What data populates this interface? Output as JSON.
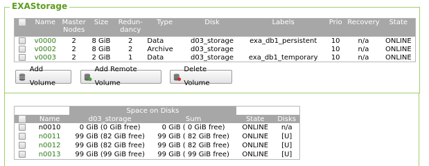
{
  "section": {
    "title": "EXAStorage"
  },
  "volumes": {
    "columns": [
      "Name",
      "Master Nodes",
      "Size",
      "Redun-dancy",
      "Type",
      "Disk",
      "Labels",
      "Prio",
      "Recovery",
      "State"
    ],
    "rows": [
      {
        "name": "v0000",
        "master_nodes": "2",
        "size": "8 GiB",
        "redundancy": "2",
        "type": "Data",
        "disk": "d03_storage",
        "labels": "exa_db1_persistent",
        "prio": "10",
        "recovery": "n/a",
        "state": "ONLINE"
      },
      {
        "name": "v0002",
        "master_nodes": "2",
        "size": "8 GiB",
        "redundancy": "2",
        "type": "Archive",
        "disk": "d03_storage",
        "labels": "",
        "prio": "10",
        "recovery": "n/a",
        "state": "ONLINE"
      },
      {
        "name": "v0003",
        "master_nodes": "2",
        "size": "2 GiB",
        "redundancy": "1",
        "type": "Data",
        "disk": "d03_storage",
        "labels": "exa_db1_temporary",
        "prio": "10",
        "recovery": "n/a",
        "state": "ONLINE"
      }
    ]
  },
  "buttons": {
    "add_volume": "Add Volume",
    "add_remote_volume": "Add Remote Volume",
    "delete_volume": "Delete Volume"
  },
  "disks": {
    "group_header": "Space on Disks",
    "columns": [
      "Name",
      "d03_storage",
      "Sum",
      "State",
      "Disks"
    ],
    "rows": [
      {
        "name": "n0010",
        "d03_storage": "0 GiB (0 GiB free)",
        "sum": "0 GiB ( 0 GiB free)",
        "state": "ONLINE",
        "disks": "n/a"
      },
      {
        "name": "n0011",
        "d03_storage": "99 GiB (82 GiB free)",
        "sum": "99 GiB ( 82 GiB free)",
        "state": "ONLINE",
        "disks": "[U]"
      },
      {
        "name": "n0012",
        "d03_storage": "99 GiB (82 GiB free)",
        "sum": "99 GiB ( 82 GiB free)",
        "state": "ONLINE",
        "disks": "[U]"
      },
      {
        "name": "n0013",
        "d03_storage": "99 GiB (99 GiB free)",
        "sum": "99 GiB ( 99 GiB free)",
        "state": "ONLINE",
        "disks": "[U]"
      }
    ]
  },
  "colors": {
    "accent_green": "#5d9c1e",
    "header_gray": "#a7a7a7",
    "link_green": "#2e7d17"
  }
}
